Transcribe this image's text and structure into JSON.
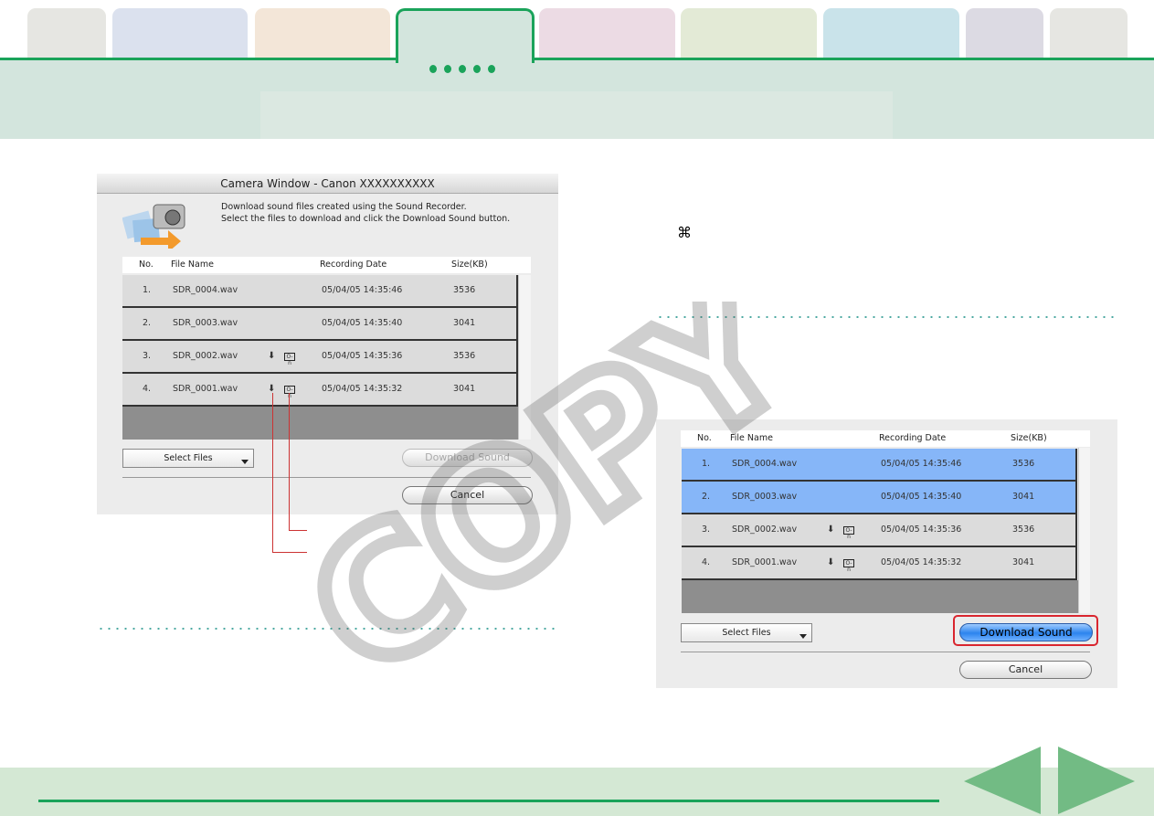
{
  "tabs": {
    "colors": [
      "#e6e6e2",
      "#dbe1ee",
      "#f3e6d8",
      "#d3e5dd",
      "#ecdbe4",
      "#e3ead6",
      "#c9e3ea",
      "#dcdae3",
      "#e6e6e2"
    ],
    "active_index": 3,
    "page_dots": 5
  },
  "dialog_left": {
    "title": "Camera Window - Canon XXXXXXXXXX",
    "message_line1": "Download sound files created using the Sound Recorder.",
    "message_line2": "Select the files to download and click the Download Sound button.",
    "columns": [
      "No.",
      "File Name",
      "Recording Date",
      "Size(KB)"
    ],
    "rows": [
      {
        "no": "1.",
        "name": "SDR_0004.wav",
        "date": "05/04/05 14:35:46",
        "size": "3536",
        "icons": false,
        "selected": false
      },
      {
        "no": "2.",
        "name": "SDR_0003.wav",
        "date": "05/04/05 14:35:40",
        "size": "3041",
        "icons": false,
        "selected": false
      },
      {
        "no": "3.",
        "name": "SDR_0002.wav",
        "date": "05/04/05 14:35:36",
        "size": "3536",
        "icons": true,
        "selected": false
      },
      {
        "no": "4.",
        "name": "SDR_0001.wav",
        "date": "05/04/05 14:35:32",
        "size": "3041",
        "icons": true,
        "selected": false
      }
    ],
    "select_files": "Select Files",
    "download_sound": "Download Sound",
    "download_enabled": false,
    "cancel": "Cancel"
  },
  "dialog_right": {
    "columns": [
      "No.",
      "File Name",
      "Recording Date",
      "Size(KB)"
    ],
    "rows": [
      {
        "no": "1.",
        "name": "SDR_0004.wav",
        "date": "05/04/05 14:35:46",
        "size": "3536",
        "icons": false,
        "selected": true
      },
      {
        "no": "2.",
        "name": "SDR_0003.wav",
        "date": "05/04/05 14:35:40",
        "size": "3041",
        "icons": false,
        "selected": true
      },
      {
        "no": "3.",
        "name": "SDR_0002.wav",
        "date": "05/04/05 14:35:36",
        "size": "3536",
        "icons": true,
        "selected": false
      },
      {
        "no": "4.",
        "name": "SDR_0001.wav",
        "date": "05/04/05 14:35:32",
        "size": "3041",
        "icons": true,
        "selected": false
      }
    ],
    "select_files": "Select Files",
    "download_sound": "Download Sound",
    "download_enabled": true,
    "cancel": "Cancel",
    "highlight_color": "#d9262f"
  },
  "command_symbol": "⌘",
  "watermark": "COPY",
  "icons": {
    "download": "download-arrow-icon",
    "protect": "protect-key-icon",
    "prev": "prev-page-icon",
    "next": "next-page-icon"
  },
  "accent_color": "#1aa35a"
}
